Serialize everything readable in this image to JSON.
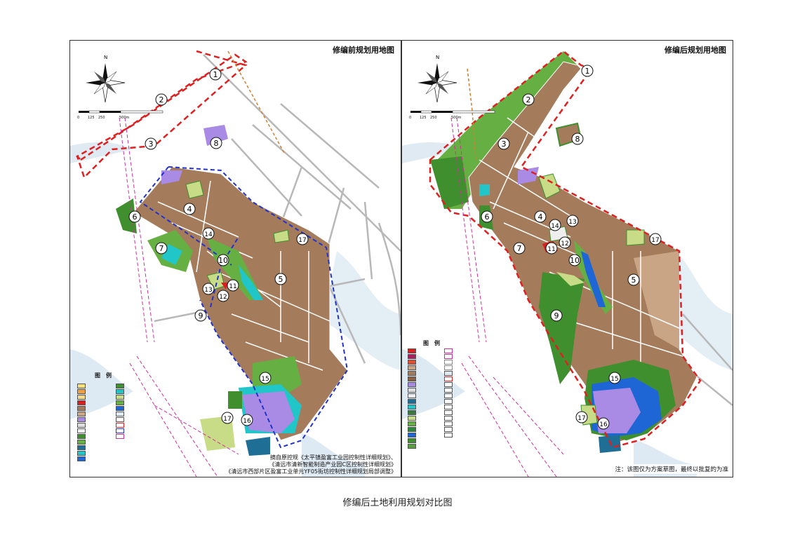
{
  "left_map": {
    "title": "修编前规划用地图",
    "legend_title": "图　例",
    "scale_labels": [
      "0",
      "125",
      "250",
      "500m"
    ],
    "north_label": "N",
    "parcel_labels": [
      "1",
      "2",
      "3",
      "4",
      "5",
      "6",
      "7",
      "8",
      "9",
      "10",
      "11",
      "12",
      "13",
      "14",
      "15",
      "16",
      "17"
    ],
    "source_notes": [
      "摘自原控规《太平镇盈富工业园控制性详细规划》、",
      "《清远市清新智能制造产业园C区控制性详细规划》",
      "《清远市西部片区盈富工业单元YF05街坊控制性详细规划局部调整》"
    ]
  },
  "right_map": {
    "title": "修编后规划用地图",
    "legend_title": "图　例",
    "scale_labels": [
      "0",
      "125",
      "250",
      "500m"
    ],
    "north_label": "N",
    "parcel_labels": [
      "1",
      "2",
      "3",
      "4",
      "5",
      "6",
      "7",
      "8",
      "9",
      "10",
      "11",
      "12",
      "13",
      "14",
      "15",
      "16",
      "17"
    ],
    "disclaimer": "注：该图仅为方案草图，最终以批复的为准"
  },
  "caption": "修编后土地利用规划对比图",
  "colors": {
    "industrial": "#a57c5b",
    "industrial_light": "#c9a585",
    "green_dark": "#3f8f2f",
    "green_mid": "#66b043",
    "green_light": "#c8dc88",
    "water": "#1e66d6",
    "water_light": "#21c6c8",
    "purple": "#a98be6",
    "red": "#d81e1e",
    "boundary_red": "#e02020",
    "boundary_blue": "#2233cc",
    "river_bg": "#dfeaf3"
  }
}
